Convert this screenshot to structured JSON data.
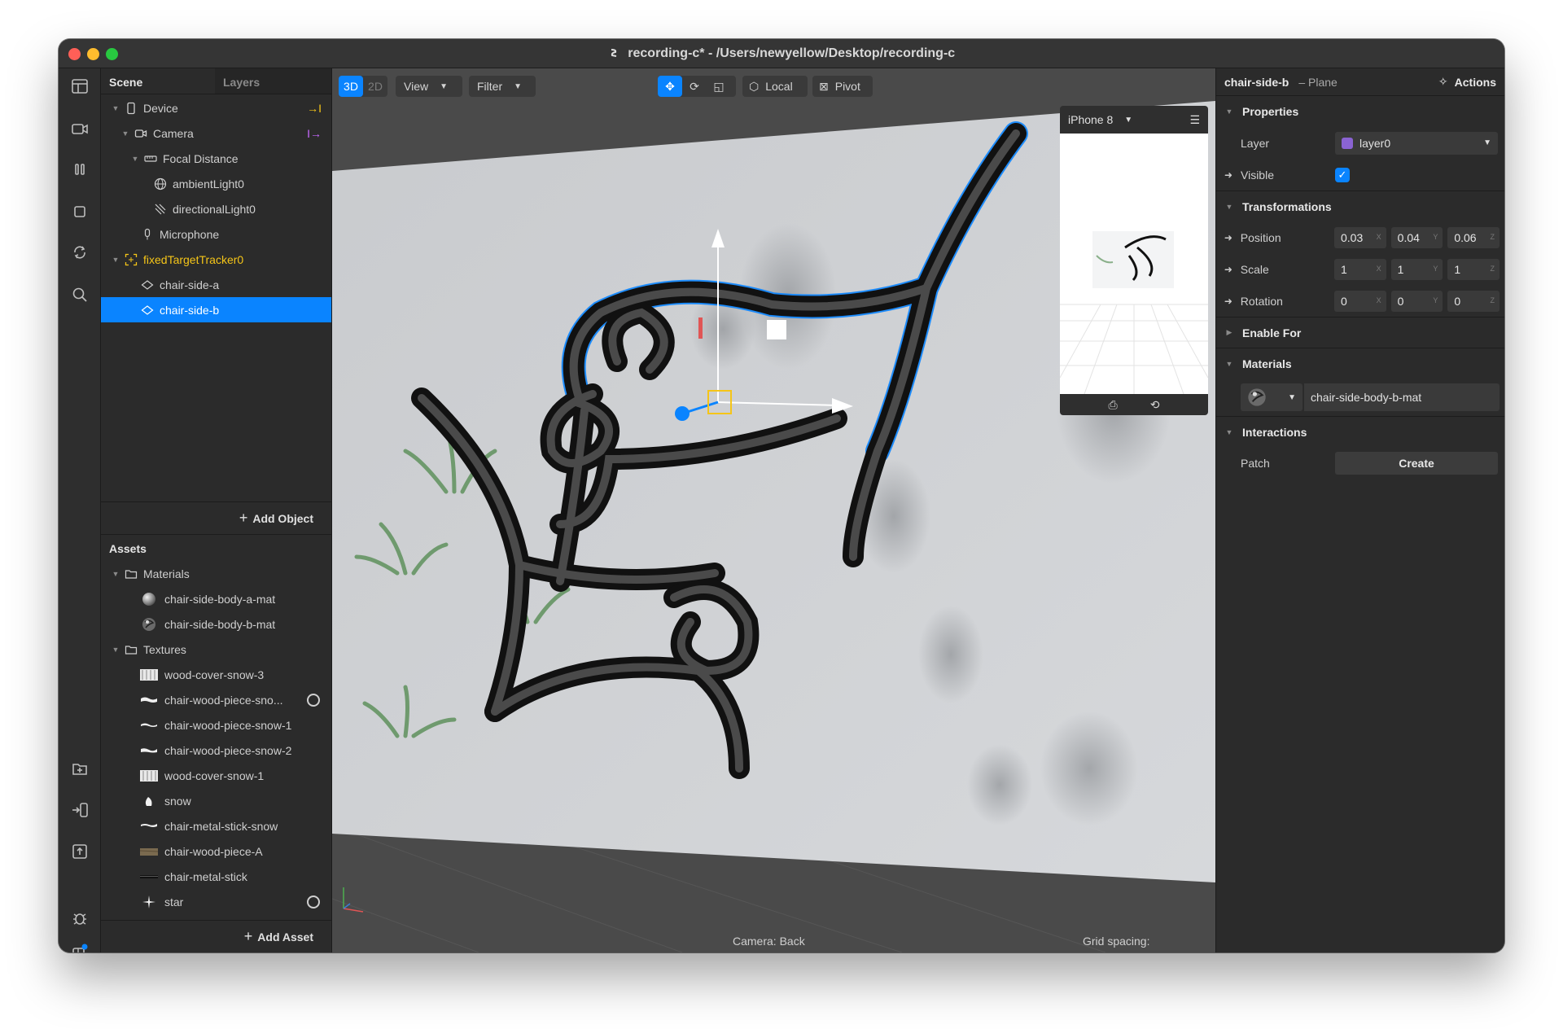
{
  "window": {
    "title": "recording-c* - /Users/newyellow/Desktop/recording-c"
  },
  "scene": {
    "tabs": [
      "Scene",
      "Layers"
    ],
    "tree": [
      {
        "label": "Device",
        "icon": "device-icon",
        "indent": 0,
        "expanded": true
      },
      {
        "label": "Camera",
        "icon": "camera-icon",
        "indent": 1,
        "expanded": true
      },
      {
        "label": "Focal Distance",
        "icon": "ruler-icon",
        "indent": 2,
        "expanded": true
      },
      {
        "label": "ambientLight0",
        "icon": "globe-icon",
        "indent": 3
      },
      {
        "label": "directionalLight0",
        "icon": "directional-light-icon",
        "indent": 3
      },
      {
        "label": "Microphone",
        "icon": "microphone-icon",
        "indent": 1
      },
      {
        "label": "fixedTargetTracker0",
        "icon": "tracker-icon",
        "indent": 0,
        "expanded": true
      },
      {
        "label": "chair-side-a",
        "icon": "plane-icon",
        "indent": 1
      },
      {
        "label": "chair-side-b",
        "icon": "plane-icon",
        "indent": 1,
        "selected": true
      }
    ],
    "add_object_label": "Add Object"
  },
  "assets": {
    "title": "Assets",
    "groups": [
      {
        "label": "Materials",
        "items": [
          "chair-side-body-a-mat",
          "chair-side-body-b-mat"
        ]
      },
      {
        "label": "Textures",
        "items": [
          "wood-cover-snow-3",
          "chair-wood-piece-sno...",
          "chair-wood-piece-snow-1",
          "chair-wood-piece-snow-2",
          "wood-cover-snow-1",
          "snow",
          "chair-metal-stick-snow",
          "chair-wood-piece-A",
          "chair-metal-stick",
          "star"
        ]
      }
    ],
    "add_asset_label": "Add Asset"
  },
  "viewport": {
    "mode_3d": "3D",
    "mode_2d": "2D",
    "view_label": "View",
    "filter_label": "Filter",
    "local_label": "Local",
    "pivot_label": "Pivot",
    "device_label": "iPhone 8",
    "camera_status": "Camera: Back",
    "grid_status": "Grid spacing:"
  },
  "inspector": {
    "object_name": "chair-side-b",
    "object_type": "– Plane",
    "actions_label": "Actions",
    "properties": {
      "title": "Properties",
      "layer_label": "Layer",
      "layer_value": "layer0",
      "layer_color": "#8a63d2",
      "visible_label": "Visible"
    },
    "transformations": {
      "title": "Transformations",
      "rows": [
        {
          "label": "Position",
          "x": "0.03",
          "y": "0.04",
          "z": "0.06"
        },
        {
          "label": "Scale",
          "x": "1",
          "y": "1",
          "z": "1"
        },
        {
          "label": "Rotation",
          "x": "0",
          "y": "0",
          "z": "0"
        }
      ]
    },
    "enable_for": {
      "title": "Enable For"
    },
    "materials": {
      "title": "Materials",
      "value": "chair-side-body-b-mat"
    },
    "interactions": {
      "title": "Interactions",
      "patch_label": "Patch",
      "create_label": "Create"
    }
  },
  "colors": {
    "accent": "#0a84ff",
    "tracker": "#f5c518"
  }
}
